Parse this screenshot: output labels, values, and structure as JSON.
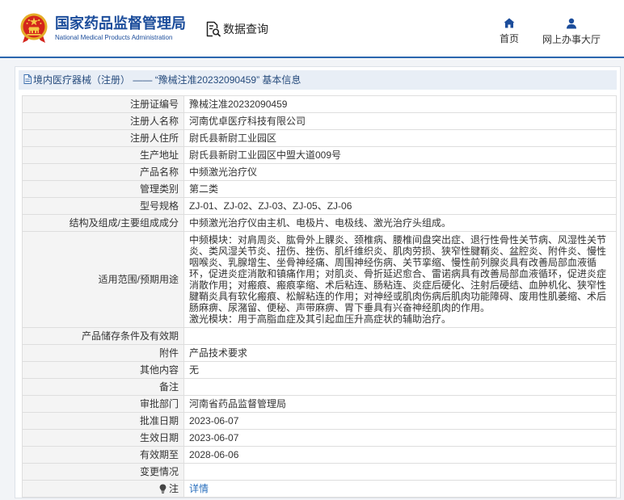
{
  "header": {
    "title": "国家药品监督管理局",
    "subtitle": "National Medical Products Administration",
    "emblem_icon": "national-emblem-icon",
    "data_query": {
      "label": "数据查询",
      "icon": "document-search-icon"
    },
    "nav": [
      {
        "label": "首页",
        "icon": "home-icon"
      },
      {
        "label": "网上办事大厅",
        "icon": "user-icon"
      }
    ]
  },
  "breadcrumb": {
    "icon": "document-icon",
    "category": "境内医疗器械（注册）",
    "separator": " —— ",
    "record_title": "“豫械注准20232090459” 基本信息"
  },
  "record": {
    "rows": [
      {
        "label": "注册证编号",
        "value": "豫械注准20232090459"
      },
      {
        "label": "注册人名称",
        "value": "河南优卓医疗科技有限公司"
      },
      {
        "label": "注册人住所",
        "value": "尉氏县新尉工业园区"
      },
      {
        "label": "生产地址",
        "value": "尉氏县新尉工业园区中盟大道009号"
      },
      {
        "label": "产品名称",
        "value": "中频激光治疗仪"
      },
      {
        "label": "管理类别",
        "value": "第二类"
      },
      {
        "label": "型号规格",
        "value": "ZJ-01、ZJ-02、ZJ-03、ZJ-05、ZJ-06"
      },
      {
        "label": "结构及组成/主要组成成分",
        "value": "中频激光治疗仪由主机、电极片、电极线、激光治疗头组成。"
      },
      {
        "label": "适用范围/预期用途",
        "lines": [
          "中频模块：对肩周炎、肱骨外上髁炎、颈椎病、腰椎间盘突出症、退行性骨性关节病、风湿性关节炎、类风湿关节炎、扭伤、挫伤、肌纤维织炎、肌肉劳损、狭窄性腱鞘炎、盆腔炎、附件炎、慢性咽喉炎、乳腺增生、坐骨神经痛、周围神经伤病、关节挛缩、慢性前列腺炎具有改善局部血液循环，促进炎症消散和镇痛作用；对肌炎、骨折延迟愈合、雷诺病具有改善局部血液循环，促进炎症消散作用；对瘢痕、瘢痕挛缩、术后粘连、肠粘连、炎症后硬化、注射后硬结、血肿机化、狭窄性腱鞘炎具有软化瘢痕、松解粘连的作用；对神经或肌肉伤病后肌肉功能障碍、废用性肌萎缩、术后肠麻痹、尿潴留、便秘、声带麻痹、胃下垂具有兴奋神经肌肉的作用。",
          "激光模块：用于高脂血症及其引起血压升高症状的辅助治疗。"
        ]
      },
      {
        "label": "产品储存条件及有效期",
        "value": ""
      },
      {
        "label": "附件",
        "value": "产品技术要求"
      },
      {
        "label": "其他内容",
        "value": "无"
      },
      {
        "label": "备注",
        "value": ""
      },
      {
        "label": "审批部门",
        "value": "河南省药品监督管理局"
      },
      {
        "label": "批准日期",
        "value": "2023-06-07"
      },
      {
        "label": "生效日期",
        "value": "2023-06-07"
      },
      {
        "label": "有效期至",
        "value": "2028-06-06"
      },
      {
        "label": "变更情况",
        "value": ""
      },
      {
        "label": "注",
        "icon": "lightbulb-icon",
        "link": "详情"
      }
    ]
  },
  "colors": {
    "brand_blue": "#1c4d9b",
    "header_rule": "#2b66ae",
    "breadcrumb_bg": "#e8eef6",
    "link_blue": "#2a6fbd",
    "emblem_red": "#d4251c",
    "emblem_gold": "#f6c846"
  }
}
